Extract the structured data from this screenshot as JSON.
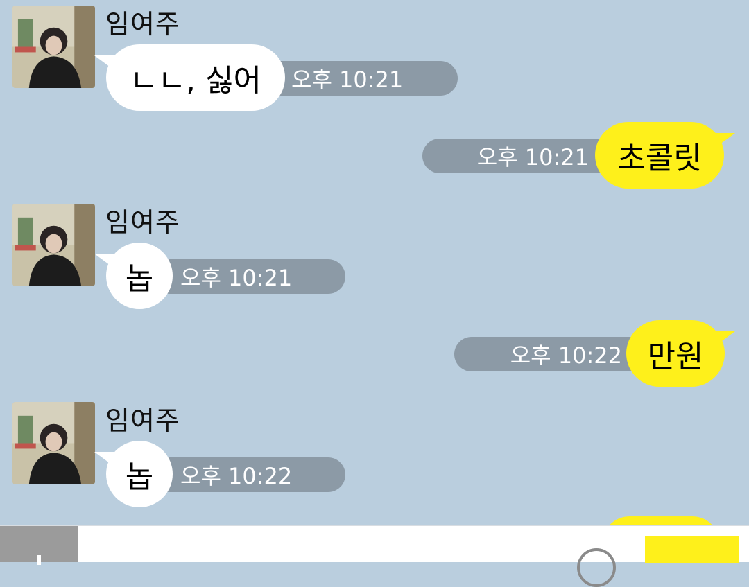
{
  "messages": [
    {
      "direction": "in",
      "sender": "임여주",
      "text": "ㄴㄴ, 싫어",
      "time": "오후 10:21"
    },
    {
      "direction": "out",
      "text": "초콜릿",
      "time": "오후 10:21"
    },
    {
      "direction": "in",
      "sender": "임여주",
      "text": "놉",
      "time": "오후 10:21"
    },
    {
      "direction": "out",
      "text": "만원",
      "time": "오후 10:22"
    },
    {
      "direction": "in",
      "sender": "임여주",
      "text": "놉",
      "time": "오후 10:22"
    }
  ],
  "colors": {
    "background": "#bacede",
    "incoming_bubble": "#ffffff",
    "outgoing_bubble": "#fef01b",
    "time_pill": "#8c9aa6"
  },
  "input_bar": {
    "left_icon": "plus-icon",
    "right_icon": "emoji-icon"
  }
}
